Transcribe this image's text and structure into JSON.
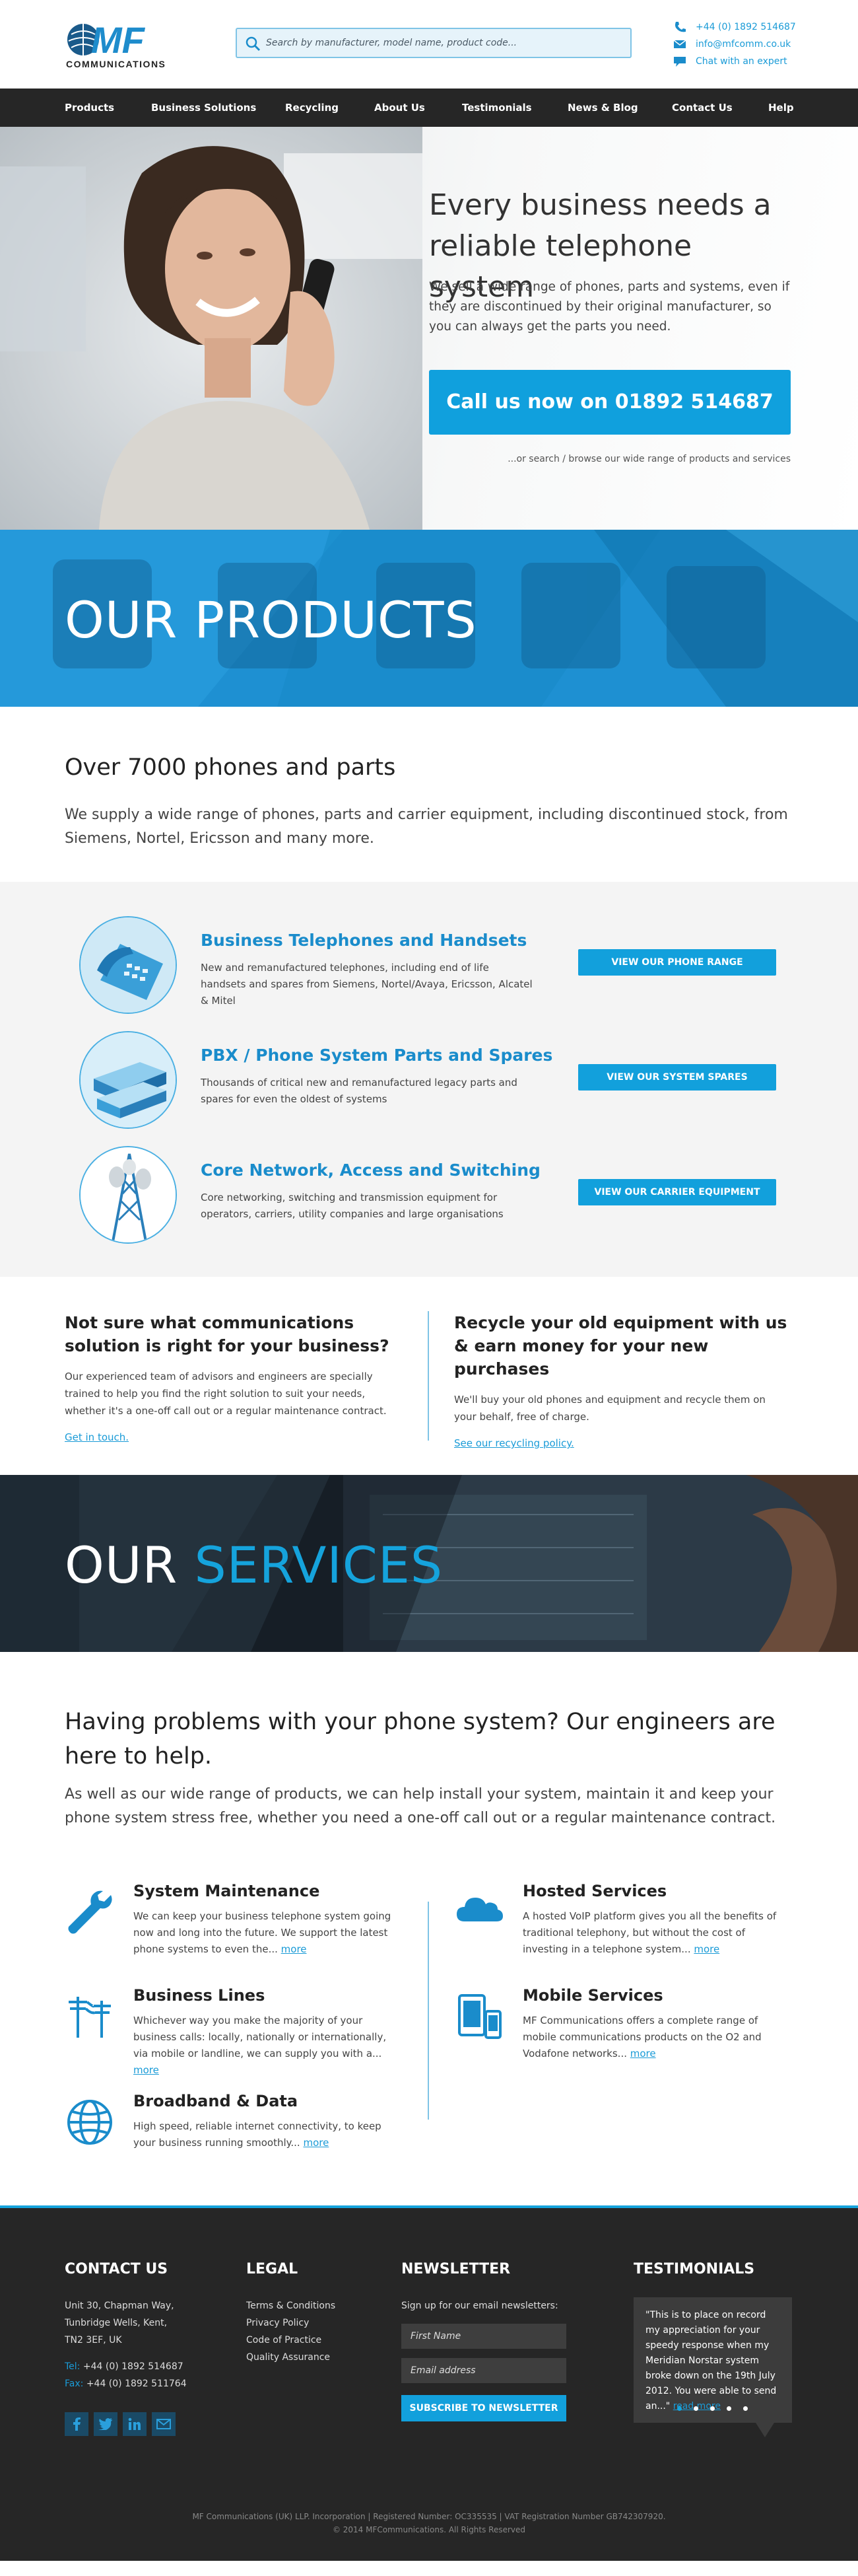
{
  "header": {
    "logo_text": "MF",
    "logo_sub": "COMMUNICATIONS",
    "search_placeholder": "Search by manufacturer, model name, product code...",
    "phone": "+44 (0) 1892 514687",
    "email": "info@mfcomm.co.uk",
    "chat": "Chat with an expert"
  },
  "nav": {
    "items": [
      "Products",
      "Business Solutions",
      "Recycling",
      "About Us",
      "Testimonials",
      "News & Blog",
      "Contact Us",
      "Help"
    ]
  },
  "hero": {
    "title": "Every business needs a reliable telephone system",
    "text": "We sell a wide range of phones, parts and systems, even if they are discontinued by their original manufacturer, so you can always get the parts you need.",
    "cta": "Call us now on 01892 514687",
    "sub": "...or search / browse our wide range of products and services"
  },
  "products_banner": {
    "title": "OUR PRODUCTS"
  },
  "intro": {
    "title": "Over 7000 phones and parts",
    "text": "We supply a wide range of phones, parts and carrier equipment, including discontinued stock, from Siemens, Nortel, Ericsson and many more."
  },
  "products": [
    {
      "title": "Business Telephones and Handsets",
      "desc": "New and remanufactured telephones, including end of life handsets and spares from Siemens, Nortel/Avaya, Ericsson, Alcatel & Mitel",
      "button": "VIEW OUR PHONE RANGE"
    },
    {
      "title": "PBX / Phone System Parts and Spares",
      "desc": "Thousands of critical new and remanufactured legacy parts and spares for even the oldest of systems",
      "button": "VIEW OUR SYSTEM SPARES"
    },
    {
      "title": "Core Network, Access and Switching",
      "desc": "Core networking, switching and transmission equipment for operators, carriers, utility companies and large organisations",
      "button": "VIEW OUR CARRIER EQUIPMENT"
    }
  ],
  "twocol": {
    "left": {
      "title": "Not sure what communications solution is right for your business?",
      "text": "Our experienced team of advisors and engineers are specially trained to help you find the right solution to suit your needs, whether it's a one-off call out or a regular maintenance contract.",
      "link": "Get in touch."
    },
    "right": {
      "title": "Recycle your old equipment with us & earn money for your new purchases",
      "text": "We'll buy your old phones and equipment and recycle them on your behalf, free of charge.",
      "link": "See our recycling policy."
    }
  },
  "services_banner": {
    "title_a": "OUR",
    "title_b": "SERVICES"
  },
  "services": {
    "title": "Having problems with your phone system? Our engineers are here to help.",
    "lead": "As well as our wide range of products, we can help install your system, maintain it and keep your phone system stress free, whether you need a one-off call out or a regular maintenance contract.",
    "more_label": "more",
    "items": [
      {
        "title": "System Maintenance",
        "text": "We can keep your business telephone system going now and long into the future. We support the latest phone systems to even the...",
        "icon": "wrench-icon"
      },
      {
        "title": "Hosted Services",
        "text": "A hosted VoIP platform gives you all the benefits of traditional telephony, but without the cost of investing in a telephone system...",
        "icon": "cloud-icon"
      },
      {
        "title": "Business Lines",
        "text": "Whichever way you make the majority of your business calls: locally, nationally or internationally, via mobile or landline, we can supply you with a...",
        "icon": "telegraph-pole-icon"
      },
      {
        "title": "Mobile Services",
        "text": "MF Communications offers a complete range of mobile communications products on the O2 and Vodafone networks...",
        "icon": "mobile-devices-icon"
      },
      {
        "title": "Broadband & Data",
        "text": "High speed, reliable internet connectivity, to keep your business running smoothly...",
        "icon": "globe-icon"
      }
    ]
  },
  "footer": {
    "contact": {
      "title": "CONTACT US",
      "address": [
        "Unit 30, Chapman Way,",
        "Tunbridge Wells, Kent,",
        "TN2 3EF, UK"
      ],
      "tel_label": "Tel:",
      "tel": "+44 (0) 1892 514687",
      "fax_label": "Fax:",
      "fax": "+44 (0) 1892 511764"
    },
    "legal": {
      "title": "LEGAL",
      "links": [
        "Terms & Conditions",
        "Privacy Policy",
        "Code of Practice",
        "Quality Assurance"
      ]
    },
    "newsletter": {
      "title": "NEWSLETTER",
      "text": "Sign up for our email newsletters:",
      "name_placeholder": "First Name",
      "email_placeholder": "Email address",
      "button": "SUBSCRIBE TO NEWSLETTER"
    },
    "testimonials": {
      "title": "TESTIMONIALS",
      "quote": "\"This is to place on record my appreciation for your speedy response when my Meridian Norstar system broke down on the 19th July 2012. You were able to send an...\"",
      "read_more": "read more"
    },
    "legal_line_1": "MF Communications (UK) LLP. Incorporation | Registered Number: OC335535 | VAT Registration Number GB742307920.",
    "legal_line_2": "© 2014 MFCommunications. All Rights Reserved"
  },
  "colors": {
    "accent": "#15a3dc",
    "nav_bg": "#262626",
    "footer_bg": "#262626",
    "title_blue": "#1a8ccb"
  }
}
